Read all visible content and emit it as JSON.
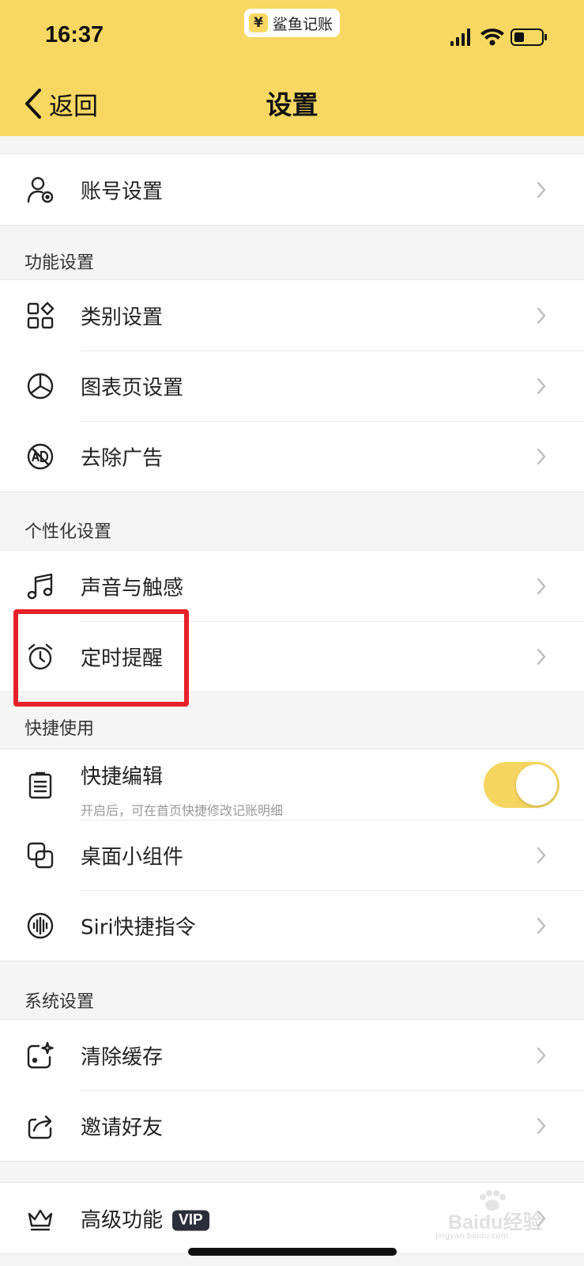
{
  "status_bar": {
    "time": "16:37",
    "app_badge": "¥",
    "app_name": "鲨鱼记账"
  },
  "nav": {
    "back_label": "返回",
    "title": "设置"
  },
  "sections": {
    "function": "功能设置",
    "personal": "个性化设置",
    "shortcut": "快捷使用",
    "system": "系统设置"
  },
  "items": {
    "account": "账号设置",
    "category": "类别设置",
    "chart_page": "图表页设置",
    "remove_ads": "去除广告",
    "sound_haptics": "声音与触感",
    "reminder": "定时提醒",
    "quick_edit": "快捷编辑",
    "quick_edit_desc": "开启后，可在首页快捷修改记账明细",
    "quick_edit_enabled": true,
    "widget": "桌面小组件",
    "siri": "Siri快捷指令",
    "clear_cache": "清除缓存",
    "invite": "邀请好友",
    "advanced": "高级功能",
    "vip_badge": "VIP"
  },
  "watermark": {
    "text": "Baidu经验",
    "url": "jingyan.baidu.com"
  },
  "colors": {
    "header_bg": "#f8d862",
    "toggle_on": "#f4d55f",
    "highlight": "#e62129",
    "vip_bg": "#2c2e3a"
  }
}
